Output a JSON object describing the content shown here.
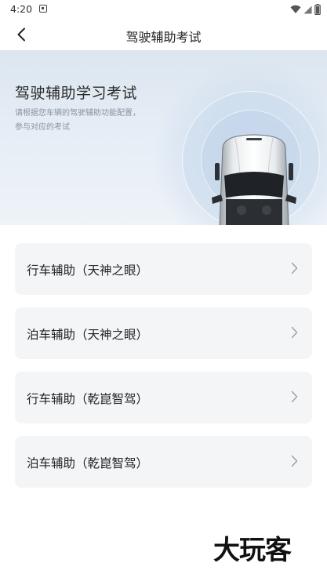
{
  "status_bar": {
    "time": "4:20"
  },
  "nav": {
    "title": "驾驶辅助考试"
  },
  "hero": {
    "title": "驾驶辅助学习考试",
    "description": "请根据您车辆的驾驶辅助功能配置，参与对应的考试"
  },
  "menu": {
    "items": [
      {
        "label": "行车辅助（天神之眼）"
      },
      {
        "label": "泊车辅助（天神之眼）"
      },
      {
        "label": "行车辅助（乾崑智驾）"
      },
      {
        "label": "泊车辅助（乾崑智驾）"
      }
    ]
  },
  "watermark": {
    "text": "大玩客"
  }
}
